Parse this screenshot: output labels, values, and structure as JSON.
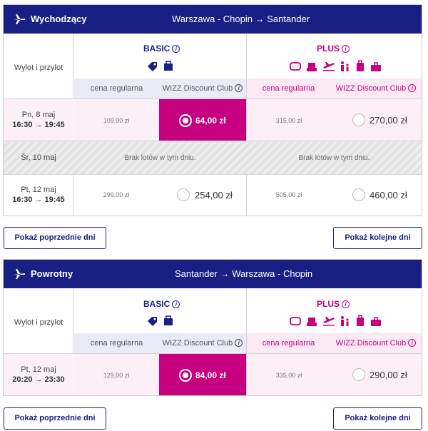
{
  "colors": {
    "navy": "#1a1f84",
    "magenta": "#c6007e"
  },
  "outbound": {
    "title": "Wychodzący",
    "route": "Warszawa - Chopin → Santander",
    "left_label": "Wylot i przylot",
    "basic": {
      "label": "BASIC",
      "icons": [
        "tag-icon",
        "bag-icon"
      ]
    },
    "plus": {
      "label": "PLUS",
      "icons": [
        "seat-icon",
        "armchair-icon",
        "plane-icon",
        "family-icon",
        "luggage-icon",
        "suitcase-icon"
      ]
    },
    "col_headers": [
      "cena regularna",
      "WIZZ Discount Club",
      "cena regularna",
      "WIZZ Discount Club"
    ],
    "rows": [
      {
        "date": "Pn, 8 maj",
        "times": "16:30 → 19:45",
        "basic_regular": "109,00 zł",
        "basic_club": "64,00 zł",
        "plus_regular": "315,00 zł",
        "plus_club": "270,00 zł",
        "selected": true
      },
      {
        "date": "Śr, 10 maj",
        "no_flights": "Brak lotów w tym dniu."
      },
      {
        "date": "Pt, 12 maj",
        "times": "16:30 → 19:45",
        "basic_regular": "299,00 zł",
        "basic_club": "254,00 zł",
        "plus_regular": "505,00 zł",
        "plus_club": "460,00 zł",
        "selected": false
      }
    ],
    "prev_label": "Pokaż poprzednie dni",
    "next_label": "Pokaż kolejne dni"
  },
  "return": {
    "title": "Powrotny",
    "route": "Santander → Warszawa - Chopin",
    "left_label": "Wylot i przylot",
    "basic": {
      "label": "BASIC"
    },
    "plus": {
      "label": "PLUS"
    },
    "col_headers": [
      "cena regularna",
      "WIZZ Discount Club",
      "cena regularna",
      "WIZZ Discount Club"
    ],
    "rows": [
      {
        "date": "Pt, 12 maj",
        "times": "20:20 → 23:30",
        "basic_regular": "129,00 zł",
        "basic_club": "84,00 zł",
        "plus_regular": "335,00 zł",
        "plus_club": "290,00 zł",
        "selected": true
      }
    ],
    "prev_label": "Pokaż poprzednie dni",
    "next_label": "Pokaż kolejne dni"
  }
}
